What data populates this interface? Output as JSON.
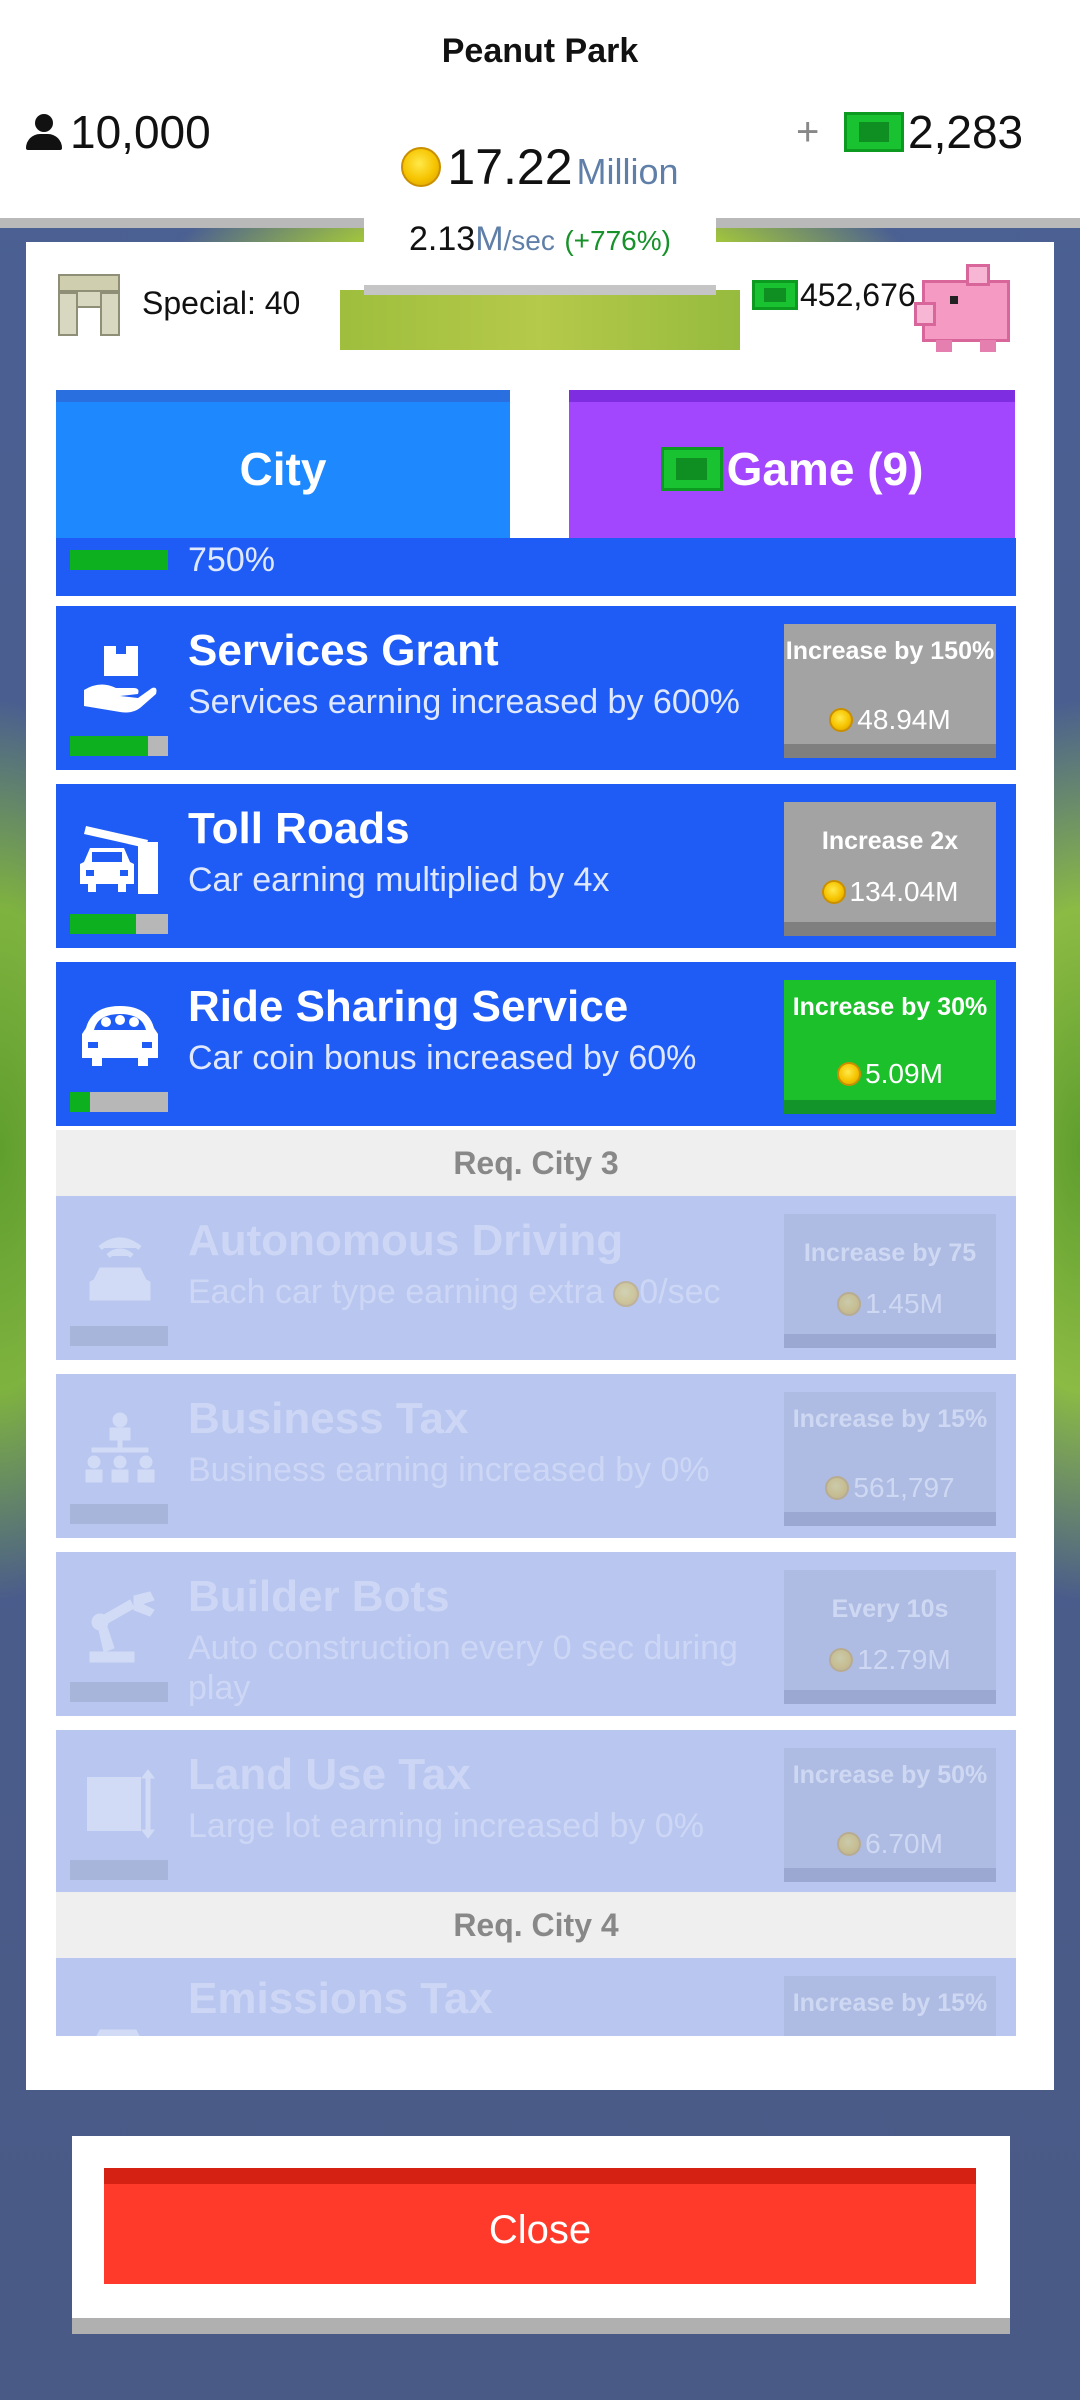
{
  "header": {
    "park_name": "Peanut Park",
    "population": "10,000",
    "coins_amount": "17.22",
    "coins_unit": "Million",
    "rate_value": "2.13",
    "rate_unit_m": "M",
    "rate_unit_sec": "/sec",
    "rate_bonus": "(+776%)",
    "cash_plus": "+",
    "cash": "2,283"
  },
  "panel": {
    "special_label": "Special: 40",
    "piggy_cash": "452,676"
  },
  "tabs": {
    "city": "City",
    "game": "Game (9)"
  },
  "upgrades": {
    "partial_top": {
      "desc": "750%",
      "progress": 1.0
    },
    "items": [
      {
        "name": "Services Grant",
        "desc": "Services earning increased by 600%",
        "button_text": "Increase by 150%",
        "cost": "48.94M",
        "progress": 0.8,
        "icon": "hand-with-box-icon",
        "locked": false,
        "button_color": "gray"
      },
      {
        "name": "Toll Roads",
        "desc": "Car earning multiplied by 4x",
        "button_text": "Increase 2x",
        "cost": "134.04M",
        "progress": 0.67,
        "icon": "toll-gate-car-icon",
        "locked": false,
        "button_color": "gray"
      },
      {
        "name": "Ride Sharing Service",
        "desc": "Car coin bonus increased by 60%",
        "button_text": "Increase by 30%",
        "cost": "5.09M",
        "progress": 0.2,
        "icon": "car-passengers-icon",
        "locked": false,
        "button_color": "green"
      }
    ],
    "req_city_3": "Req. City 3",
    "locked_items": [
      {
        "name": "Autonomous Driving",
        "desc": "Each car type earning extra",
        "desc_suffix": "0/sec",
        "button_text": "Increase by 75",
        "cost": "1.45M",
        "icon": "wifi-car-icon"
      },
      {
        "name": "Business Tax",
        "desc": "Business earning increased by 0%",
        "button_text": "Increase by 15%",
        "cost": "561,797",
        "icon": "org-chart-icon"
      },
      {
        "name": "Builder Bots",
        "desc": "Auto construction every 0 sec during play",
        "button_text": "Every 10s",
        "cost": "12.79M",
        "icon": "robot-arm-icon"
      },
      {
        "name": "Land Use Tax",
        "desc": "Large lot earning increased by 0%",
        "button_text": "Increase by 50%",
        "cost": "6.70M",
        "icon": "measure-square-icon"
      }
    ],
    "req_city_4": "Req. City 4",
    "partial_bottom": {
      "name": "Emissions Tax",
      "button_text": "Increase by 15%"
    }
  },
  "close_label": "Close",
  "colors": {
    "tab_city": "#1e88ff",
    "tab_game": "#a347ff",
    "row_active": "#1f5cf5",
    "row_locked": "#b8c6f0",
    "buy_green": "#1cc02a",
    "close_red": "#ff3a2a"
  }
}
